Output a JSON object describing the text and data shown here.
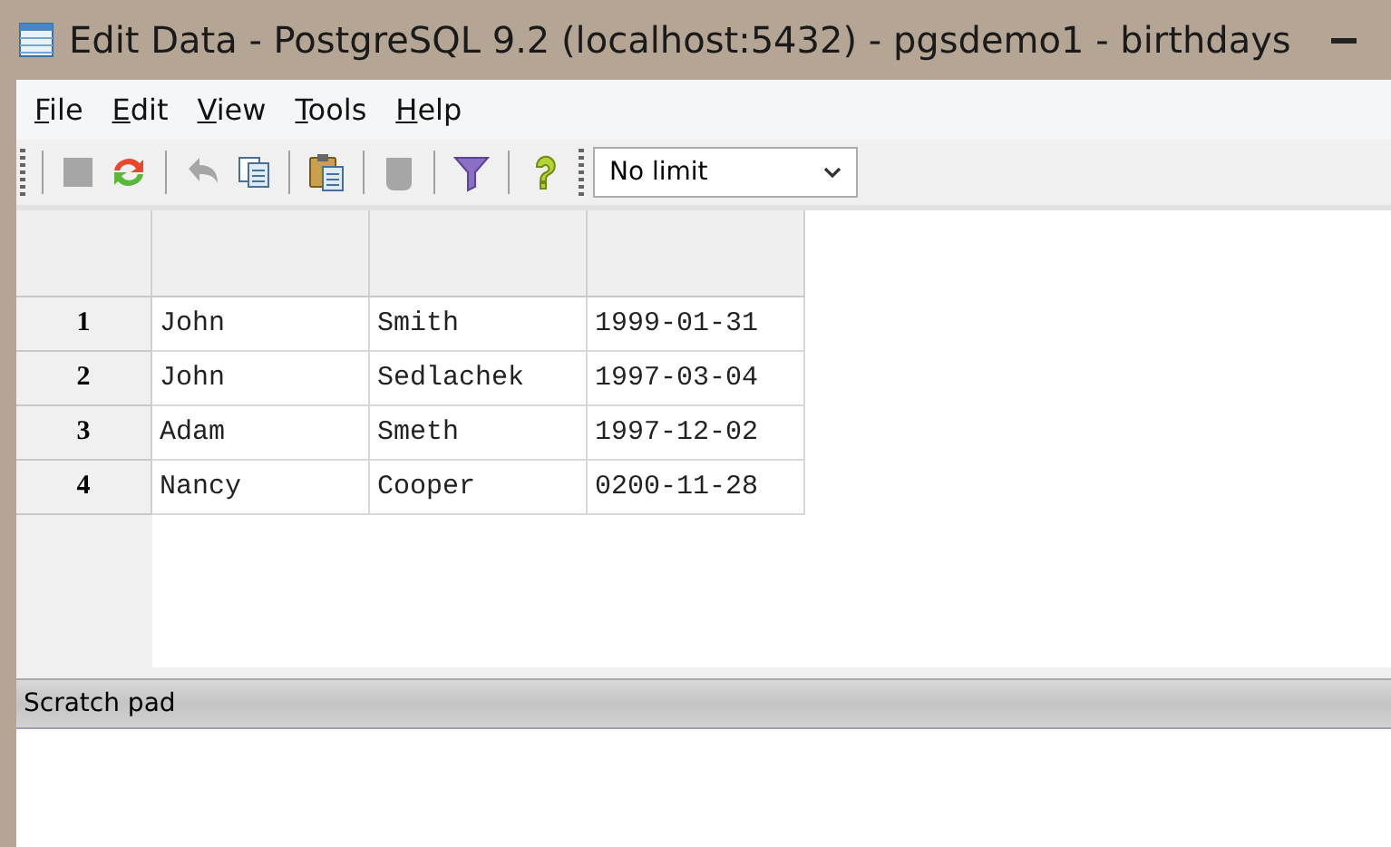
{
  "window": {
    "title": "Edit Data - PostgreSQL 9.2 (localhost:5432) - pgsdemo1 - birthdays"
  },
  "menu": [
    {
      "label": "File"
    },
    {
      "label": "Edit"
    },
    {
      "label": "View"
    },
    {
      "label": "Tools"
    },
    {
      "label": "Help"
    }
  ],
  "toolbar": {
    "buttons": [
      {
        "kind": "stop",
        "disabled": true
      },
      {
        "kind": "refresh",
        "disabled": false
      },
      {
        "kind": "undo",
        "disabled": true
      },
      {
        "kind": "copy",
        "disabled": false
      },
      {
        "kind": "paste",
        "disabled": false
      },
      {
        "kind": "delete",
        "disabled": true
      },
      {
        "kind": "filter",
        "disabled": false
      },
      {
        "kind": "help",
        "disabled": false
      }
    ],
    "limit": {
      "value": "No limit"
    }
  },
  "table": {
    "rows": [
      {
        "number": "1",
        "cells": [
          "John",
          "Smith",
          "1999-01-31"
        ]
      },
      {
        "number": "2",
        "cells": [
          "John",
          "Sedlachek",
          "1997-03-04"
        ]
      },
      {
        "number": "3",
        "cells": [
          "Adam",
          "Smeth",
          "1997-12-02"
        ]
      },
      {
        "number": "4",
        "cells": [
          "Nancy",
          "Cooper",
          "0200-11-28"
        ]
      }
    ]
  },
  "scratch_pad": {
    "title": "Scratch pad"
  }
}
